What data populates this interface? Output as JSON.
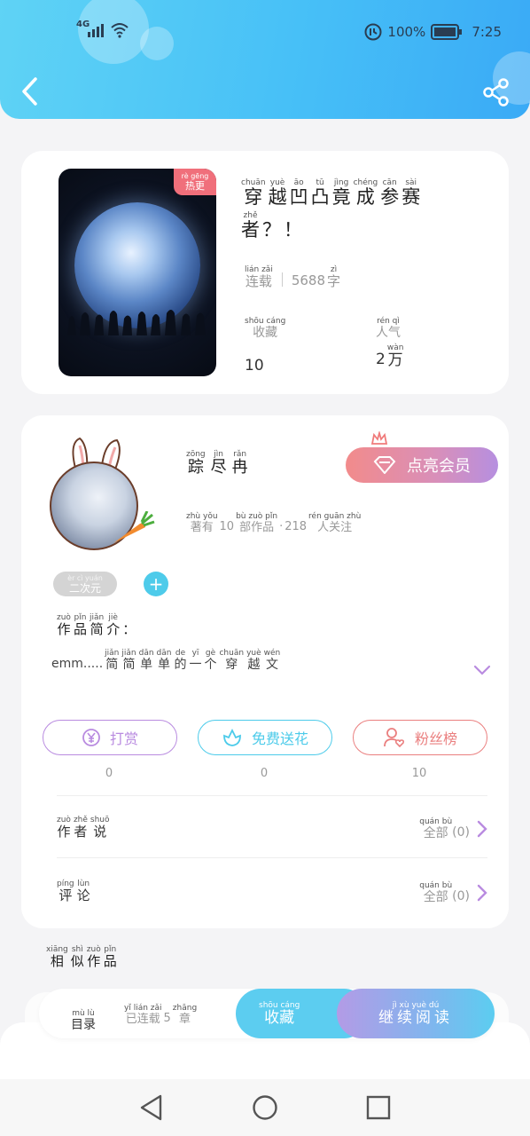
{
  "status": {
    "network": "4G",
    "battery": "100%",
    "time": "7:25"
  },
  "book": {
    "badge_py": "rè gēng",
    "badge": "热更",
    "title_line1": [
      {
        "py": "chuān",
        "hz": "穿"
      },
      {
        "py": "yuè",
        "hz": "越"
      },
      {
        "py": "āo",
        "hz": "凹"
      },
      {
        "py": "tū",
        "hz": "凸"
      },
      {
        "py": "jìng",
        "hz": "竟"
      },
      {
        "py": "chéng",
        "hz": "成"
      },
      {
        "py": "cān",
        "hz": "参"
      },
      {
        "py": "sài",
        "hz": "赛"
      }
    ],
    "title_line2": [
      {
        "py": "zhě",
        "hz": "者"
      },
      {
        "py": "",
        "hz": "？"
      },
      {
        "py": "",
        "hz": "！"
      }
    ],
    "status_py": "lián zǎi",
    "status": "连载",
    "word_count": "5688",
    "word_unit_py": "zì",
    "word_unit": "字",
    "favorites_label_py": "shōu cáng",
    "favorites_label": "收藏",
    "favorites_value": "10",
    "popularity_label_py": "rén qì",
    "popularity_label": "人气",
    "popularity_value": "2",
    "popularity_unit_py": "wàn",
    "popularity_unit": "万"
  },
  "author": {
    "name": [
      {
        "py": "zōng",
        "hz": "踪"
      },
      {
        "py": "jìn",
        "hz": "尽"
      },
      {
        "py": "rǎn",
        "hz": "冉"
      }
    ],
    "vip_button": "点亮会员",
    "stats_prefix_py": "zhù yǒu",
    "stats_prefix": "著有",
    "works_count": "10",
    "works_unit_py": "bù zuò pǐn",
    "works_unit": "部作品",
    "followers": "218",
    "followers_unit_py": "rén guān zhù",
    "followers_unit": "人关注",
    "tag_py": "èr cì yuán",
    "tag": "二次元",
    "intro_label": [
      {
        "py": "zuò",
        "hz": "作"
      },
      {
        "py": "pǐn",
        "hz": "品"
      },
      {
        "py": "jiǎn",
        "hz": "简"
      },
      {
        "py": "jiè",
        "hz": "介"
      },
      {
        "py": "",
        "hz": "："
      }
    ],
    "intro_prefix": "emm.....",
    "intro_text": [
      {
        "py": "jiǎn",
        "hz": "简"
      },
      {
        "py": "jiǎn",
        "hz": "简"
      },
      {
        "py": "dān",
        "hz": "单"
      },
      {
        "py": "dān",
        "hz": "单"
      },
      {
        "py": "de",
        "hz": "的"
      },
      {
        "py": "yī",
        "hz": "一"
      },
      {
        "py": "gè",
        "hz": "个"
      },
      {
        "py": "chuān",
        "hz": "穿"
      },
      {
        "py": "yuè",
        "hz": "越"
      },
      {
        "py": "wén",
        "hz": "文"
      }
    ]
  },
  "actions": [
    {
      "label": "打赏",
      "count": "0",
      "color": "#b98be0"
    },
    {
      "label": "免费送花",
      "count": "0",
      "color": "#4ccbea"
    },
    {
      "label": "粉丝榜",
      "count": "10",
      "color": "#ea7f7f"
    }
  ],
  "rows": {
    "author_says": [
      {
        "py": "zuò",
        "hz": "作"
      },
      {
        "py": "zhě",
        "hz": "者"
      },
      {
        "py": "shuō",
        "hz": "说"
      }
    ],
    "author_says_right_py": "quán bù",
    "author_says_right": "全部",
    "author_says_count": "(0)",
    "comments": [
      {
        "py": "píng",
        "hz": "评"
      },
      {
        "py": "lùn",
        "hz": "论"
      }
    ],
    "comments_right_py": "quán bù",
    "comments_right": "全部",
    "comments_count": "(0)"
  },
  "similar": [
    {
      "py": "xiāng",
      "hz": "相"
    },
    {
      "py": "shì",
      "hz": "似"
    },
    {
      "py": "zuò",
      "hz": "作"
    },
    {
      "py": "pǐn",
      "hz": "品"
    }
  ],
  "bottom": {
    "catalog_py": "mù lù",
    "catalog": "目录",
    "chapters_prefix_py": "yǐ lián zǎi",
    "chapters_prefix": "已连载",
    "chapters_count": "5",
    "chapters_unit_py": "zhāng",
    "chapters_unit": "章",
    "collect_py": "shōu cáng",
    "collect": "收藏",
    "read_py": "jì xù yuè dú",
    "read": "继续阅读"
  }
}
